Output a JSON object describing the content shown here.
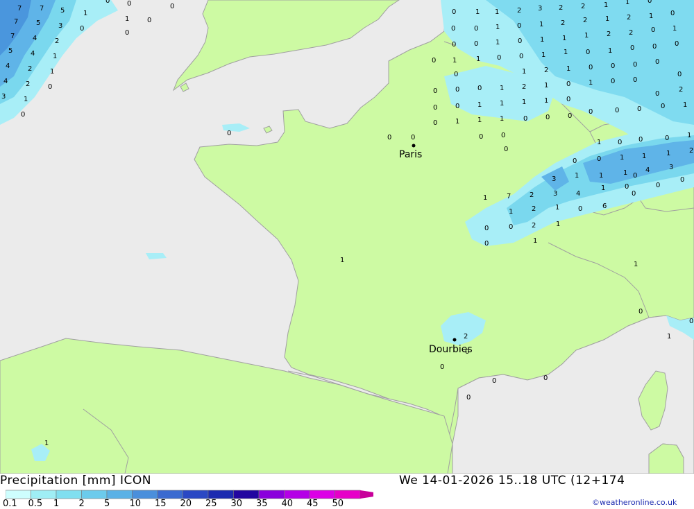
{
  "title": "Precipitation [mm] ICON",
  "datetime": "We 14-01-2026 15..18 UTC (12+174",
  "credit": "©weatheronline.co.uk",
  "colors": {
    "sea": "#ebebeb",
    "land": "#cdfaa3",
    "border": "#a0a0a0",
    "precip_light": "#a8eef7",
    "precip_mid": "#7ad8ee",
    "precip_strong": "#5fb4e8",
    "precip_heavy": "#4a96dd"
  },
  "legend": {
    "labels": [
      "0.1",
      "0.5",
      "1",
      "2",
      "5",
      "10",
      "15",
      "20",
      "25",
      "30",
      "35",
      "40",
      "45",
      "50"
    ],
    "colors": [
      "#cefefe",
      "#9feef5",
      "#80dff0",
      "#6ccbec",
      "#5ab1e6",
      "#4a8fdc",
      "#3a6ad0",
      "#2a48c4",
      "#1c2bb0",
      "#2206a0",
      "#8a00dc",
      "#b400e6",
      "#dc00e6",
      "#e600c8",
      "#c8009a"
    ]
  },
  "cities": [
    {
      "name": "Paris"
    },
    {
      "name": "Dourbies"
    }
  ],
  "values": [
    "7",
    "7",
    "5",
    "1",
    "0",
    "0",
    "0",
    "7",
    "5",
    "3",
    "0",
    "1",
    "0",
    "7",
    "4",
    "2",
    "0",
    "5",
    "4",
    "1",
    "4",
    "2",
    "1",
    "4",
    "2",
    "0",
    "3",
    "1",
    "0",
    "0",
    "0",
    "0",
    "0",
    "0",
    "0",
    "0",
    "1",
    "1",
    "1",
    "2",
    "3",
    "2",
    "2",
    "1",
    "1",
    "0",
    "0",
    "1",
    "0",
    "1",
    "2",
    "2",
    "1",
    "2",
    "1",
    "0",
    "0",
    "1",
    "0",
    "1",
    "1",
    "1",
    "2",
    "2",
    "0",
    "1",
    "0",
    "1",
    "0",
    "0",
    "1",
    "1",
    "0",
    "1",
    "0",
    "0",
    "0",
    "0",
    "0",
    "0",
    "1",
    "1",
    "2",
    "1",
    "0",
    "0",
    "0",
    "0",
    "0",
    "0",
    "0",
    "1",
    "1",
    "2",
    "1",
    "0",
    "1",
    "0",
    "0",
    "0",
    "2",
    "0",
    "1",
    "1",
    "1",
    "1",
    "1",
    "0",
    "0",
    "0",
    "0",
    "0",
    "1",
    "0",
    "0",
    "0",
    "0",
    "0",
    "0",
    "1",
    "0",
    "0",
    "0",
    "1",
    "0",
    "0",
    "1",
    "1",
    "1",
    "2",
    "1",
    "1",
    "1",
    "4",
    "3",
    "3",
    "4",
    "1",
    "0",
    "1",
    "7",
    "2",
    "3",
    "0",
    "6",
    "1",
    "2",
    "1",
    "0",
    "0",
    "2",
    "1",
    "0",
    "1",
    "1",
    "1",
    "0",
    "1",
    "0",
    "2",
    "0",
    "0",
    "0",
    "0",
    "0",
    "1",
    "0",
    "0",
    "0",
    "0",
    "0",
    "0",
    "0",
    "0",
    "2",
    "0",
    "0",
    "1",
    "0",
    "0"
  ]
}
